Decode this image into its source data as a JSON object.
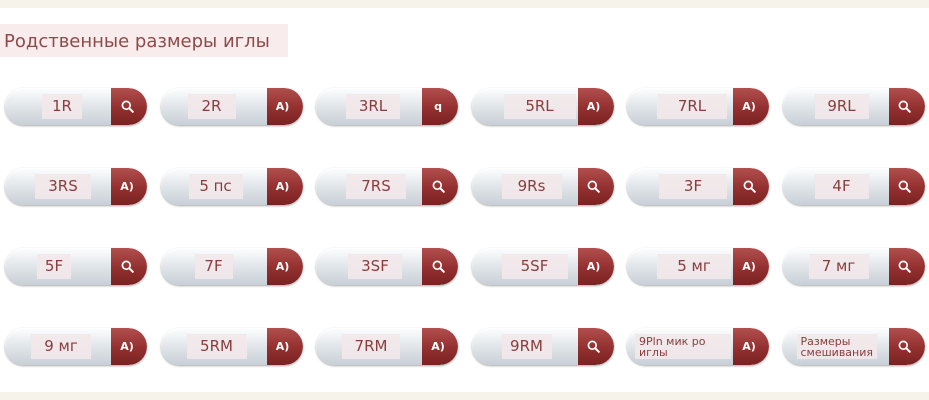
{
  "section": {
    "title": "Родственные размеры иглы"
  },
  "colors": {
    "accent": "#93302f",
    "title_text": "#8e4a4a",
    "label_bg": "#f2e8ea"
  },
  "buttons": [
    {
      "label": "1R",
      "icon": "search-icon",
      "glyph": ""
    },
    {
      "label": "2R",
      "icon": "text",
      "glyph": "A)"
    },
    {
      "label": "3RL",
      "icon": "text",
      "glyph": "q"
    },
    {
      "label": "5RL",
      "icon": "text",
      "glyph": "A)"
    },
    {
      "label": "7RL",
      "icon": "text",
      "glyph": "A)"
    },
    {
      "label": "9RL",
      "icon": "search-icon",
      "glyph": ""
    },
    {
      "label": "3RS",
      "icon": "text",
      "glyph": "A)"
    },
    {
      "label": "5 пс",
      "icon": "text",
      "glyph": "A)"
    },
    {
      "label": "7RS",
      "icon": "search-icon",
      "glyph": ""
    },
    {
      "label": "9Rs",
      "icon": "search-icon",
      "glyph": ""
    },
    {
      "label": "3F",
      "icon": "search-icon",
      "glyph": ""
    },
    {
      "label": "4F",
      "icon": "search-icon",
      "glyph": ""
    },
    {
      "label": "5F",
      "icon": "search-icon",
      "glyph": ""
    },
    {
      "label": "7F",
      "icon": "text",
      "glyph": "A)"
    },
    {
      "label": "3SF",
      "icon": "search-icon",
      "glyph": ""
    },
    {
      "label": "5SF",
      "icon": "text",
      "glyph": "A)"
    },
    {
      "label": "5 мг",
      "icon": "text",
      "glyph": "A)"
    },
    {
      "label": "7 мг",
      "icon": "search-icon",
      "glyph": ""
    },
    {
      "label": "9 мг",
      "icon": "text",
      "glyph": "A)"
    },
    {
      "label": "5RM",
      "icon": "text",
      "glyph": "A)"
    },
    {
      "label": "7RM",
      "icon": "text",
      "glyph": "A)"
    },
    {
      "label": "9RM",
      "icon": "search-icon",
      "glyph": ""
    },
    {
      "label": "9Pln мик ро иглы",
      "icon": "text",
      "glyph": "A)"
    },
    {
      "label": "Размеры смешивания",
      "icon": "search-icon",
      "glyph": ""
    }
  ]
}
